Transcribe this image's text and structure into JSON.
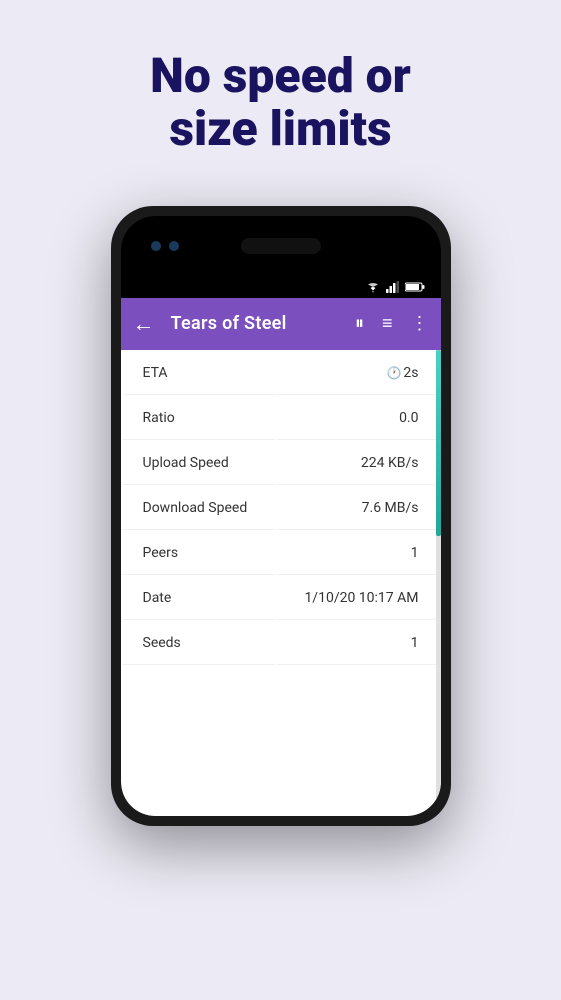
{
  "page": {
    "background_color": "#eceaf4",
    "headline": {
      "line1": "No speed or",
      "line2": "size limits"
    },
    "phone": {
      "status_bar": {
        "icons": [
          "wifi",
          "signal",
          "battery"
        ]
      },
      "app_bar": {
        "title": "Tears of Steel",
        "back_label": "←",
        "pause_label": "⏸",
        "list_label": "≡",
        "menu_label": "⋮"
      },
      "info_rows": [
        {
          "label": "ETA",
          "value": "2s",
          "has_clock": true
        },
        {
          "label": "Ratio",
          "value": "0.0",
          "has_clock": false
        },
        {
          "label": "Upload Speed",
          "value": "224 KB/s",
          "has_clock": false
        },
        {
          "label": "Download Speed",
          "value": "7.6 MB/s",
          "has_clock": false
        },
        {
          "label": "Peers",
          "value": "1",
          "has_clock": false
        },
        {
          "label": "Date",
          "value": "1/10/20 10:17 AM",
          "has_clock": false
        },
        {
          "label": "Seeds",
          "value": "1",
          "has_clock": false
        }
      ]
    }
  }
}
